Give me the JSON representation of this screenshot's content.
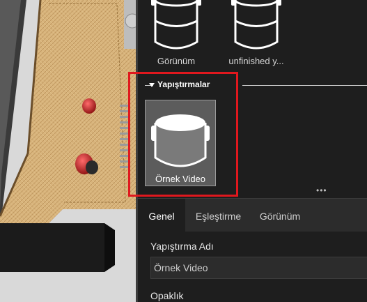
{
  "materials": {
    "items": [
      {
        "label": "Görünüm"
      },
      {
        "label": "unfinished y..."
      }
    ]
  },
  "decals": {
    "section_title": "Yapıştırmalar",
    "item": {
      "label": "Örnek Video"
    }
  },
  "tabs": [
    {
      "label": "Genel"
    },
    {
      "label": "Eşleştirme"
    },
    {
      "label": "Görünüm"
    }
  ],
  "properties": {
    "name_label": "Yapıştırma Adı",
    "name_value": "Örnek Video",
    "opacity_label": "Opaklık"
  },
  "colors": {
    "highlight": "#e0181e",
    "panel_bg": "#1e1e1e",
    "wood": "#d6b07a"
  },
  "icons": [
    "paint-can-icon",
    "section-collapse-icon",
    "panel-resize-handle-icon"
  ]
}
